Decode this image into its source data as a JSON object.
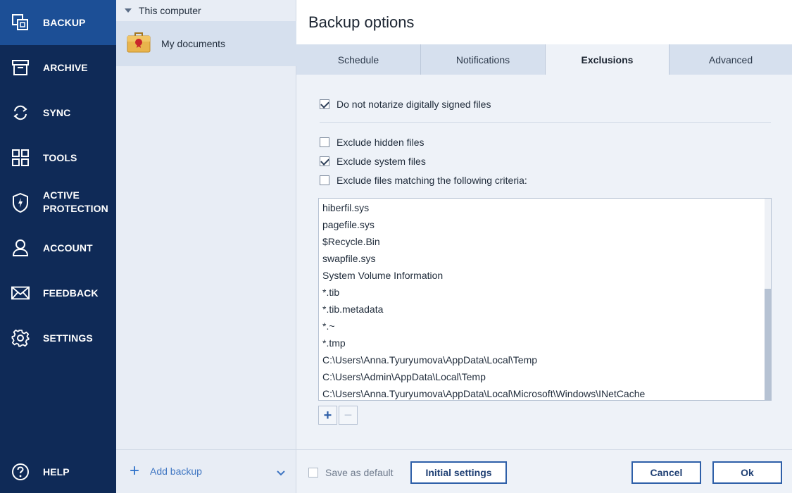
{
  "nav": {
    "items": [
      {
        "label": "BACKUP",
        "icon": "backup-icon",
        "active": true
      },
      {
        "label": "ARCHIVE",
        "icon": "archive-icon"
      },
      {
        "label": "SYNC",
        "icon": "sync-icon"
      },
      {
        "label": "TOOLS",
        "icon": "tools-icon"
      },
      {
        "label": "ACTIVE",
        "label2": "PROTECTION",
        "icon": "shield-icon"
      },
      {
        "label": "ACCOUNT",
        "icon": "account-icon"
      },
      {
        "label": "FEEDBACK",
        "icon": "envelope-icon"
      },
      {
        "label": "SETTINGS",
        "icon": "gear-icon"
      },
      {
        "label": "HELP",
        "icon": "help-icon"
      }
    ]
  },
  "sources": {
    "header": "This computer",
    "items": [
      {
        "label": "My documents",
        "icon": "briefcase-icon",
        "selected": true
      }
    ],
    "add_backup": "Add backup"
  },
  "main": {
    "title": "Backup options",
    "tabs": [
      {
        "label": "Schedule"
      },
      {
        "label": "Notifications"
      },
      {
        "label": "Exclusions",
        "active": true
      },
      {
        "label": "Advanced"
      }
    ],
    "options": [
      {
        "label": "Do not notarize digitally signed files",
        "checked": true
      },
      {
        "label": "Exclude hidden files",
        "checked": false
      },
      {
        "label": "Exclude system files",
        "checked": true
      },
      {
        "label": "Exclude files matching the following criteria:",
        "checked": false
      }
    ],
    "exclusions": [
      "hiberfil.sys",
      "pagefile.sys",
      "$Recycle.Bin",
      "swapfile.sys",
      "System Volume Information",
      "*.tib",
      "*.tib.metadata",
      "*.~",
      "*.tmp",
      "C:\\Users\\Anna.Tyuryumova\\AppData\\Local\\Temp",
      "C:\\Users\\Admin\\AppData\\Local\\Temp",
      "C:\\Users\\Anna.Tyuryumova\\AppData\\Local\\Microsoft\\Windows\\INetCache"
    ],
    "add_symbol": "+",
    "remove_symbol": "−"
  },
  "footer": {
    "save_default": "Save as default",
    "save_default_checked": false,
    "initial_settings": "Initial settings",
    "cancel": "Cancel",
    "ok": "Ok"
  },
  "colors": {
    "nav_bg": "#0f2a57",
    "nav_active": "#1c4f96",
    "accent": "#2e5fa8"
  }
}
